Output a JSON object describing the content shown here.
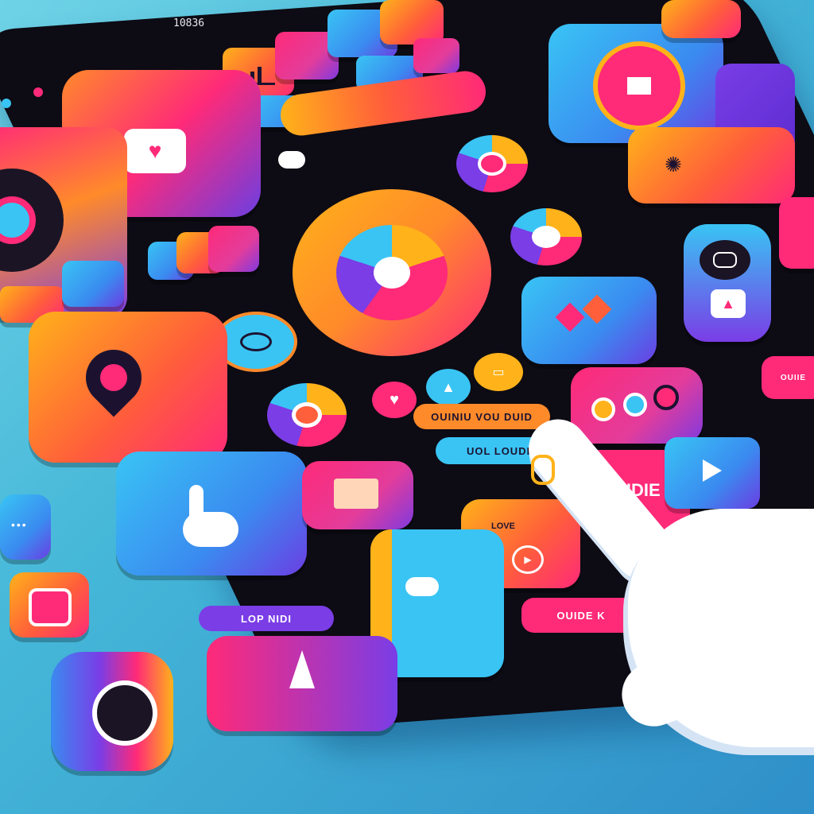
{
  "status_bar": {
    "time": "10836"
  },
  "labels": {
    "pill_orange": "OUINIU VOU DUID",
    "pill_blue": "UOL LOUDIIII",
    "tile_pink_text": "NIDIE",
    "love_text": "LOVE",
    "guide_text": "OUIDE K",
    "purple_pill": "LOP NIDI",
    "right_pill": "OUIIE"
  },
  "icons": [
    "heart-bubble-icon",
    "location-pin-icon",
    "pointer-hand-icon",
    "mail-icon",
    "play-icon",
    "cursor-arrow-icon",
    "record-icon",
    "camera-icon",
    "chat-icon",
    "alert-icon",
    "diamond-shapes-icon",
    "eye-icon",
    "chart-icon",
    "settings-icon"
  ],
  "colors": {
    "accent_orange": "#ffb21a",
    "accent_pink": "#ff2a78",
    "accent_blue": "#39c4f4",
    "accent_purple": "#7a3de6",
    "dark": "#0d0b14"
  }
}
